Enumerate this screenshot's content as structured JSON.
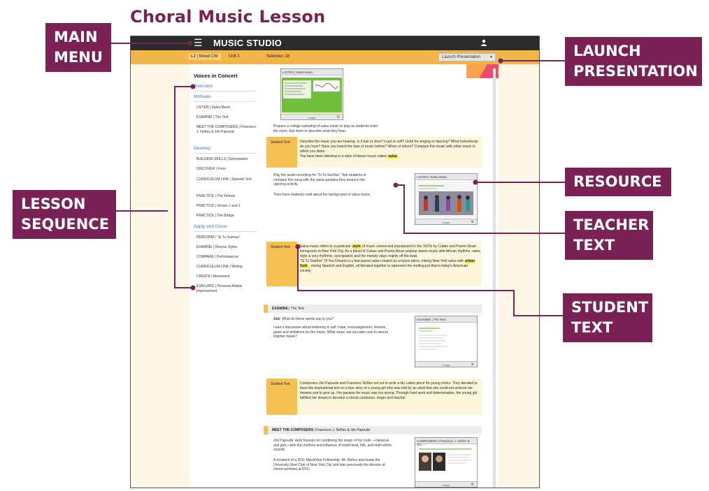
{
  "heading": "Choral Music Lesson",
  "callouts": {
    "main_menu": [
      "MAIN",
      "MENU"
    ],
    "launch_presentation": [
      "LAUNCH",
      "PRESENTATION"
    ],
    "lesson_sequence": [
      "LESSON",
      "SEQUENCE"
    ],
    "resource": [
      "RESOURCE"
    ],
    "teacher_text": [
      "TEACHER",
      "TEXT"
    ],
    "student_text": [
      "STUDENT",
      "TEXT"
    ]
  },
  "app": {
    "menu_label": "Menu",
    "brand": "MUSIC STUDIO",
    "breadcrumbs": [
      "L2 | Mixed CM",
      "Unit 1",
      "Selection 18"
    ],
    "launch_button": "Launch Presentation"
  },
  "sidebar": {
    "title": "Voices in Concert",
    "overview": "Overview",
    "sections": [
      {
        "label": "Motivate",
        "items": [
          "LISTEN | Salsa Music",
          "EXAMINE | The Text",
          "MEET THE COMPOSERS | Francisco J. Núñez & Jim Papoulis"
        ]
      },
      {
        "label": "Develop",
        "items": [
          "BUILDING SKILLS | Syncopation",
          "DISCOVER | Form",
          "CURRICULUM LINK | Spanish Text",
          "PRACTICE | The Refrain",
          "PRACTICE | Verses 1 and 2",
          "PRACTICE | The Bridge"
        ]
      },
      {
        "label": "Apply and Close",
        "items": [
          "PERFORM | \"Si Tu Suenas\"",
          "EXAMINE | Diverse Styles",
          "COMPARE | Performances",
          "CURRICULUM LINK | Writing",
          "CREATE | Movement",
          "EVALUATE | Personal Artistic Improvement"
        ]
      }
    ]
  },
  "content": {
    "listen_thumb_title": "LISTEN | Salsa Music",
    "thumb_footer": "Image",
    "listen_prompt": "Prepare a collage sampling of salsa music to play as students enter the room. Ask them to describe what they hear.",
    "student_text_label": "Student Text",
    "student_box_1": {
      "body": "Describe the music you are hearing. Is it fast or slow? Loud or soft? Used for singing or dancing? What instruments do you hear? Have you heard this type of music before? When or where? Compare this music with other music to which you listen.",
      "line2_pre": "You have been listening to a style of dance music called",
      "line2_hl": "salsa",
      "line2_post": "."
    },
    "teacher_para_1": "Play the audio recording for \"Si Tu Sueñas.\" Ask students to compare this song with the salsa samples they heard in the opening activity.",
    "teacher_para_2": "Then have students read about the background of salsa music.",
    "resource_thumb_title": "LISTEN | Salsa Music",
    "student_box_2": {
      "p1_pre": "Salsa music refers to a particular",
      "p1_hl": "style",
      "p1_post": "of music coined and popularized in the 1970s by Cuban and Puerto Rican immigrants in New York City. As a blend of Cuban and Puerto Rican popular dance music with African rhythms, salsa style is very rhythmic, syncopated, and the melody stays mainly off the beat.",
      "p2_pre": "\"Si Tu Sueñas\" (If You Dream) is a fast-paced salsa created as a fusion piece, mixing New York salsa with",
      "p2_hl": "urban funk",
      "p2_post": ", mixing Spanish and English, all blended together to represent the melting pot that is today's American society."
    },
    "examine_header": {
      "bold": "EXAMINE",
      "rest": "| The Text"
    },
    "ask_label": "Ask:",
    "ask_text": "What do these words say to you?",
    "examine_para": "Lead a discussion about believing in self, hope, encouragement, dreams, goals and ambitions for the future. What steps can you take now to assure brighter future?",
    "examine_thumb_title": "EXAMINE | The Text",
    "student_box_3": "Composers Jim Papoulis and Francisco Núñez set out to write a hip Latino piece for young choirs. They decided to base the inspirational text on a true story of a young girl who was told by an adult that she could not achieve her dreams and to give up. Her passion for music was too strong. Through hard work and determination, the young girl fulfilled her dream to become a choral conductor, singer and teacher.",
    "composers_header": {
      "bold": "MEET THE COMPOSERS",
      "rest": "| Francisco J. Núñez & Jim Papoulis"
    },
    "composers_para_1": "Jim Papoulis' work focuses on combining the music of his roots —classical and jazz—with the rhythms and influence of world beat, folk, and multi-ethnic sounds.",
    "composers_para_2": "A recipient of a 2011 MacArthur Fellowship, Mr. Núñez also leads the University Glee Club of New York City and was previously the director of choral activities at NYU.",
    "composers_thumb_title": "COMPOSERS | Francisco J. Núñez & Jim..."
  },
  "colors": {
    "callout": "#7a2155",
    "heading": "#7a2155",
    "student_tab": "#f6c050",
    "student_bg": "#fef6da",
    "topbar": "#2b2b2b",
    "navbar": "#f3b54a",
    "highlight": "#f7e94a"
  }
}
